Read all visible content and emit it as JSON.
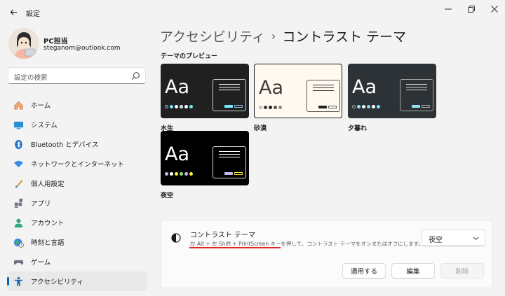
{
  "window": {
    "title": "設定"
  },
  "profile": {
    "name": "PC担当",
    "email": "steganom@outlook.com"
  },
  "search": {
    "placeholder": "設定の検索"
  },
  "sidebar": {
    "items": [
      {
        "label": "ホーム",
        "icon": "home-icon"
      },
      {
        "label": "システム",
        "icon": "system-icon"
      },
      {
        "label": "Bluetooth とデバイス",
        "icon": "bluetooth-icon"
      },
      {
        "label": "ネットワークとインターネット",
        "icon": "network-icon"
      },
      {
        "label": "個人用設定",
        "icon": "personalization-icon"
      },
      {
        "label": "アプリ",
        "icon": "apps-icon"
      },
      {
        "label": "アカウント",
        "icon": "account-icon"
      },
      {
        "label": "時刻と言語",
        "icon": "time-language-icon"
      },
      {
        "label": "ゲーム",
        "icon": "gaming-icon"
      },
      {
        "label": "アクセシビリティ",
        "icon": "accessibility-icon",
        "active": true
      }
    ]
  },
  "breadcrumb": {
    "parent": "アクセシビリティ",
    "separator": "›",
    "current": "コントラスト テーマ"
  },
  "preview": {
    "heading": "テーマのプレビュー"
  },
  "themes": [
    {
      "name": "水生",
      "aa": "Aa",
      "selected": false
    },
    {
      "name": "砂漠",
      "aa": "Aa",
      "selected": true
    },
    {
      "name": "夕暮れ",
      "aa": "Aa",
      "selected": false
    },
    {
      "name": "夜空",
      "aa": "Aa",
      "selected": false
    }
  ],
  "contrast": {
    "title": "コントラスト テーマ",
    "description": "左 Alt + 左 Shift + PrintScreen キーを押して、コントラスト テーマをオンまたはオフにします。",
    "selected": "夜空",
    "apply_label": "適用する",
    "edit_label": "編集",
    "delete_label": "削除"
  },
  "colors": {
    "accent": "#0067c0",
    "highlight_underline": "#e02828"
  }
}
